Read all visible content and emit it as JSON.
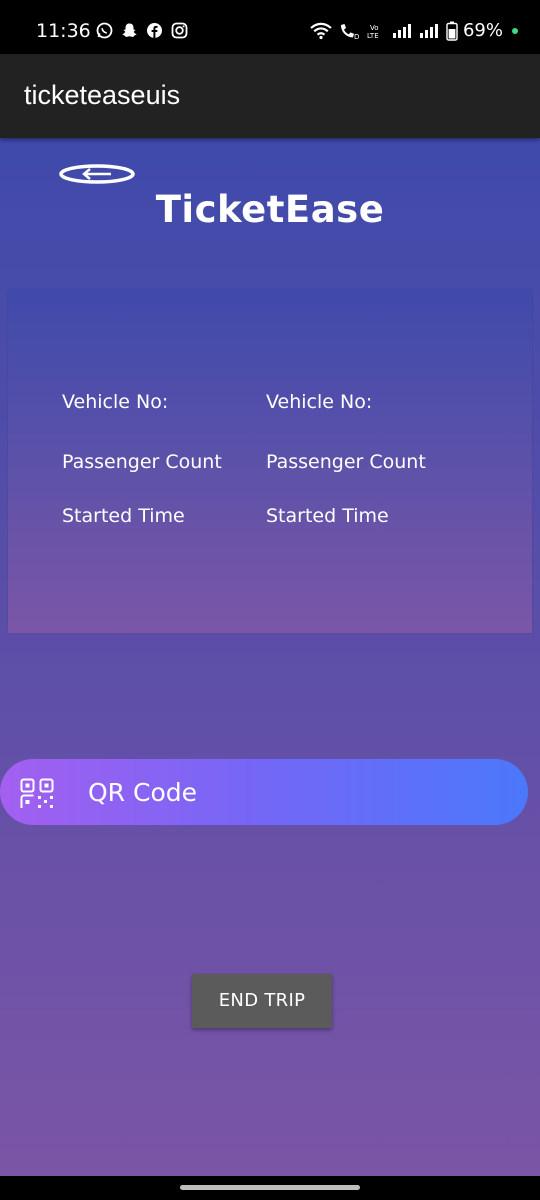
{
  "status_bar": {
    "time": "11:36",
    "left_icons": [
      "whatsapp-icon",
      "snapchat-icon",
      "facebook-icon",
      "instagram-icon"
    ],
    "right_icons": [
      "wifi-icon",
      "volte-call-icon",
      "volte-lte-icon",
      "signal-icon",
      "signal-icon",
      "battery-icon"
    ],
    "battery_text": "69%"
  },
  "app_bar": {
    "title": "ticketeaseuis"
  },
  "header": {
    "back_icon": "back-arrow-icon",
    "brand": "TicketEase"
  },
  "trip_info": {
    "labels": {
      "vehicle": "Vehicle No:",
      "passenger": "Passenger Count",
      "started": "Started Time"
    },
    "values": {
      "vehicle": "Vehicle No:",
      "passenger": "Passenger Count",
      "started": "Started Time"
    }
  },
  "qr_button": {
    "icon": "qr-code-icon",
    "label": "QR Code"
  },
  "end_trip_button": {
    "label": "END TRIP"
  },
  "colors": {
    "app_bar": "#222222",
    "background_top": "#3f4aab",
    "background_bottom": "#7b55a6",
    "qr_gradient_start": "#a35ff0",
    "qr_gradient_end": "#4b78fb",
    "end_trip_button": "#5b5b5b"
  }
}
